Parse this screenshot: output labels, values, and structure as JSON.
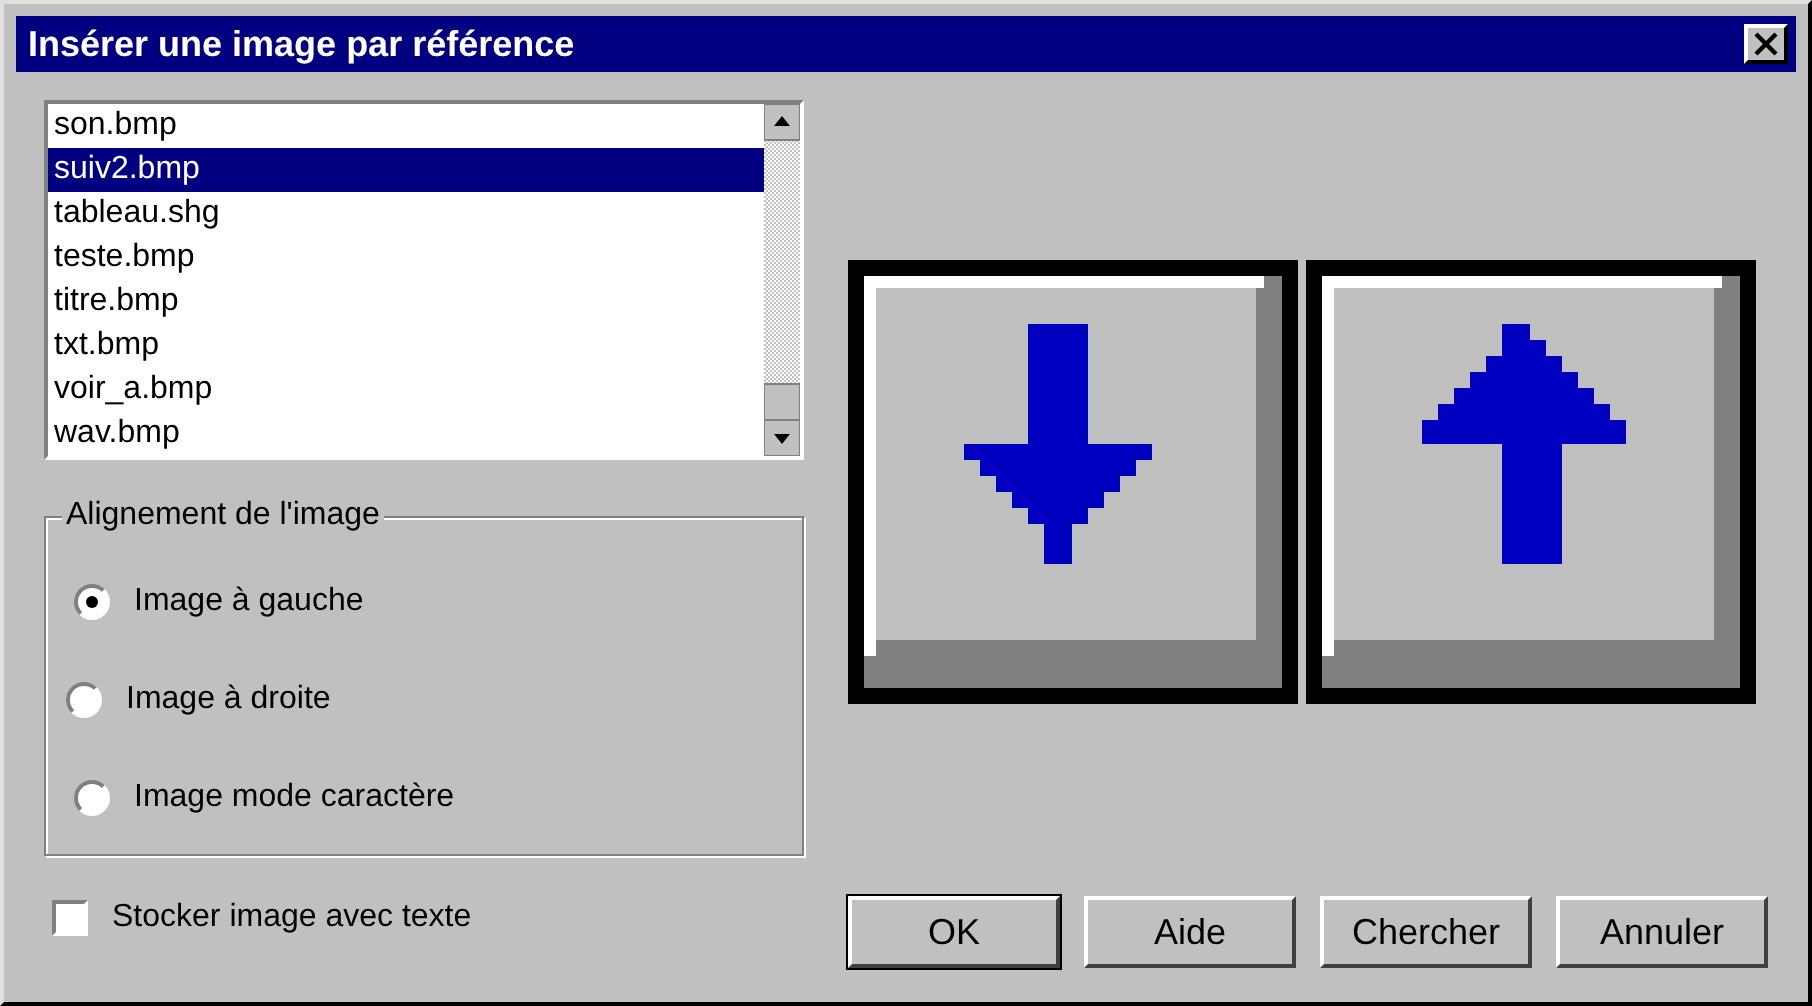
{
  "window": {
    "title": "Insérer une image par référence"
  },
  "file_list": {
    "items": [
      {
        "label": "son.bmp",
        "selected": false
      },
      {
        "label": "suiv2.bmp",
        "selected": true
      },
      {
        "label": "tableau.shg",
        "selected": false
      },
      {
        "label": "teste.bmp",
        "selected": false
      },
      {
        "label": "titre.bmp",
        "selected": false
      },
      {
        "label": "txt.bmp",
        "selected": false
      },
      {
        "label": "voir_a.bmp",
        "selected": false
      },
      {
        "label": "wav.bmp",
        "selected": false
      }
    ]
  },
  "alignment": {
    "legend": "Alignement de l'image",
    "options": [
      {
        "label": "Image à gauche",
        "selected": true
      },
      {
        "label": "Image à droite",
        "selected": false
      },
      {
        "label": "Image mode caractère",
        "selected": false
      }
    ]
  },
  "store_with_text": {
    "label": "Stocker image avec texte",
    "checked": false
  },
  "buttons": [
    {
      "label": "OK",
      "default": true
    },
    {
      "label": "Aide",
      "default": false
    },
    {
      "label": "Chercher",
      "default": false
    },
    {
      "label": "Annuler",
      "default": false
    }
  ]
}
